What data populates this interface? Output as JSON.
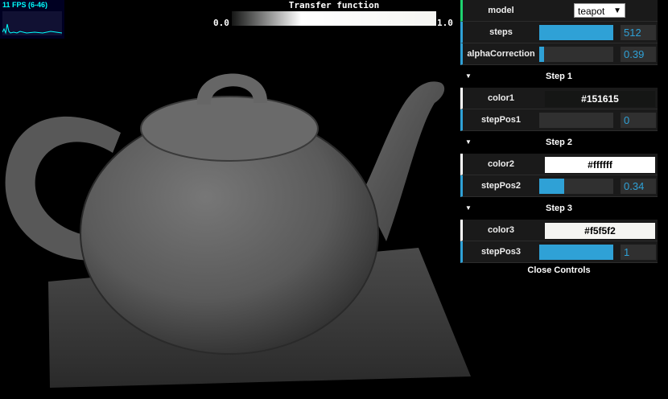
{
  "stats": {
    "fps_text": "11 FPS (6-46)"
  },
  "transfer_function": {
    "title": "Transfer function",
    "min_label": "0.0",
    "max_label": "1.0"
  },
  "controls": {
    "model": {
      "label": "model",
      "value": "teapot"
    },
    "steps": {
      "label": "steps",
      "value": "512",
      "fraction": 1.0
    },
    "alphaCorrection": {
      "label": "alphaCorrection",
      "value": "0.39",
      "fraction": 0.07
    },
    "step1": {
      "title": "Step 1",
      "color": {
        "label": "color1",
        "value": "#151615",
        "swatch": "#151615",
        "text_color": "#ffffff"
      },
      "pos": {
        "label": "stepPos1",
        "value": "0",
        "fraction": 0.0
      }
    },
    "step2": {
      "title": "Step 2",
      "color": {
        "label": "color2",
        "value": "#ffffff",
        "swatch": "#ffffff",
        "text_color": "#000000"
      },
      "pos": {
        "label": "stepPos2",
        "value": "0.34",
        "fraction": 0.34
      }
    },
    "step3": {
      "title": "Step 3",
      "color": {
        "label": "color3",
        "value": "#f5f5f2",
        "swatch": "#f5f5f2",
        "text_color": "#000000"
      },
      "pos": {
        "label": "stepPos3",
        "value": "1",
        "fraction": 1.0
      }
    },
    "close_label": "Close Controls"
  },
  "colors": {
    "accent": "#2fa1d6",
    "number_text": "#2fa1d6",
    "select_border": "#1ed36f"
  }
}
